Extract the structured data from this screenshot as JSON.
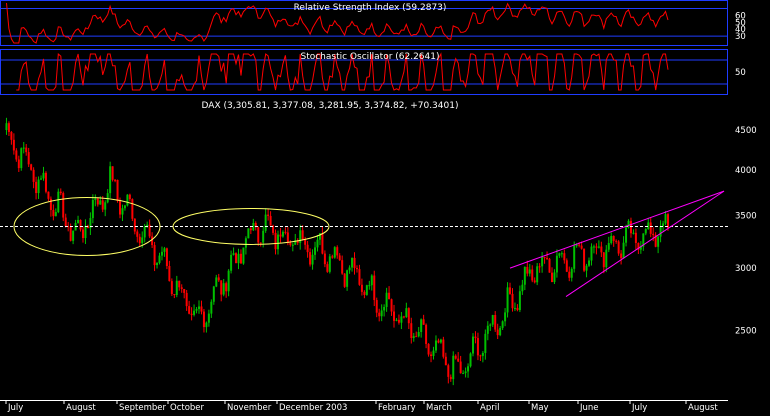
{
  "chart_data": [
    {
      "type": "line",
      "title": "Relative Strength Index (59.2873)",
      "yticks": [
        30,
        40,
        50,
        60
      ],
      "ylim": [
        20,
        78
      ],
      "reference_lines": [
        70,
        30
      ],
      "colors": {
        "series": "#ff0000",
        "reference": "#1f3cff",
        "frame": "#1f3cff"
      }
    },
    {
      "type": "line",
      "title": "Stochastic Oscillator (62.2641)",
      "yticks": [
        50
      ],
      "ylim": [
        0,
        100
      ],
      "reference_lines": [
        80,
        20
      ],
      "colors": {
        "series": "#ff0000",
        "reference": "#1f3cff",
        "frame": "#1f3cff"
      }
    },
    {
      "type": "candlestick",
      "title": "DAX (3,305.81, 3,377.08, 3,281.95, 3,374.82, +70.3401)",
      "scale": "log",
      "ylim": [
        2050,
        4700
      ],
      "yticks": [
        2500,
        3000,
        3500,
        4000,
        4500
      ],
      "xticks": [
        "July",
        "August",
        "September",
        "October",
        "November",
        "December 2003",
        "February",
        "March",
        "April",
        "May",
        "June",
        "July",
        "August"
      ],
      "colors": {
        "up": "#00c000",
        "down": "#ff0000",
        "ellipse": "#ffff66",
        "channel": "#ff00ff",
        "hline": "#ffffff"
      },
      "key_points": [
        {
          "date": "early July",
          "value": 4500
        },
        {
          "date": "late July",
          "value": 3300
        },
        {
          "date": "mid August",
          "value": 3850
        },
        {
          "date": "late September",
          "value": 3000
        },
        {
          "date": "early October",
          "value": 2550
        },
        {
          "date": "mid November",
          "value": 3400
        },
        {
          "date": "early January",
          "value": 3150
        },
        {
          "date": "mid March",
          "value": 2200
        },
        {
          "date": "mid May",
          "value": 3000
        },
        {
          "date": "mid July",
          "value": 3374.82
        }
      ],
      "horizontal_line": 3390,
      "annotations": [
        {
          "type": "ellipse",
          "label": ""
        },
        {
          "type": "ellipse",
          "label": ""
        },
        {
          "type": "channel",
          "label": ""
        }
      ]
    }
  ]
}
